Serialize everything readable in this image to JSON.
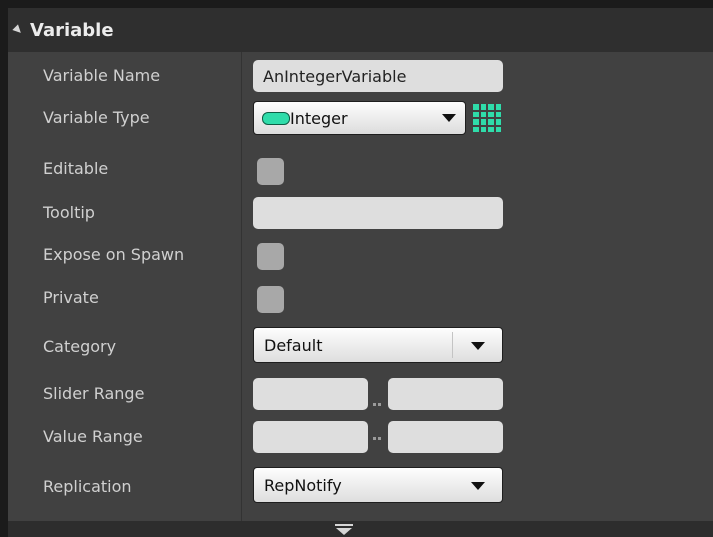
{
  "section": {
    "title": "Variable"
  },
  "fields": {
    "variable_name": {
      "label": "Variable Name",
      "value": "AnIntegerVariable"
    },
    "variable_type": {
      "label": "Variable Type",
      "value": "Integer",
      "pill_color": "#2fdcaa",
      "icon": "pill-icon",
      "container_icon": "grid-icon"
    },
    "editable": {
      "label": "Editable",
      "checked": false
    },
    "tooltip": {
      "label": "Tooltip",
      "value": ""
    },
    "expose_on_spawn": {
      "label": "Expose on Spawn",
      "checked": false
    },
    "private": {
      "label": "Private",
      "checked": false
    },
    "category": {
      "label": "Category",
      "value": "Default"
    },
    "slider_range": {
      "label": "Slider Range",
      "min": "",
      "max": "",
      "separator": ".."
    },
    "value_range": {
      "label": "Value Range",
      "min": "",
      "max": "",
      "separator": ".."
    },
    "replication": {
      "label": "Replication",
      "value": "RepNotify"
    }
  },
  "colors": {
    "panel_bg": "#414141",
    "header_bg": "#2f2f2f",
    "accent_integer": "#2fdcaa"
  }
}
